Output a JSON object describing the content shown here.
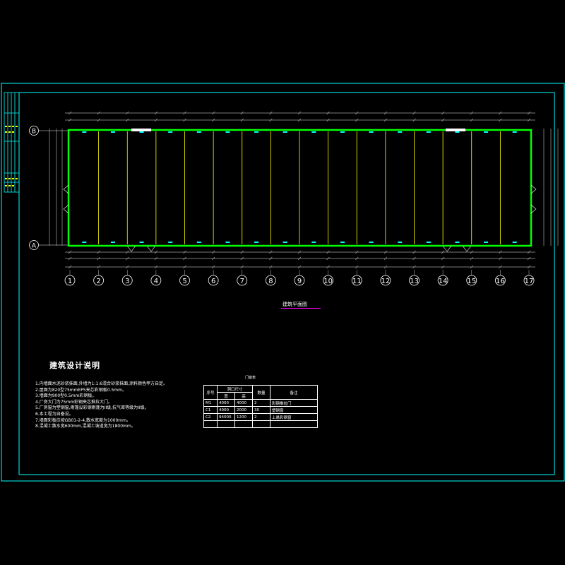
{
  "colors": {
    "background": "#000000",
    "frame": "#00ffff",
    "wall": "#00ff00",
    "grid": "#ffff00",
    "dimension": "#a0a0a0",
    "title_underline": "#ff00ff"
  },
  "plan": {
    "title": "建筑平面图",
    "axis_columns": [
      "1",
      "2",
      "3",
      "4",
      "5",
      "6",
      "7",
      "8",
      "9",
      "10",
      "11",
      "12",
      "13",
      "14",
      "15",
      "16",
      "17"
    ],
    "axis_rows": [
      "B",
      "A"
    ]
  },
  "notes": {
    "title": "建筑设计说明",
    "items": [
      "1.内墙面水泥砂浆抹面,外墙为1:1:6混合砂浆抹面,涂料颜色甲方自定。",
      "2.屋面为820型75mmEPS夹芯彩钢板0.5mm。",
      "3.墙面为900型0.5mm彩钢板。",
      "4.厂房大门为75mm彩钢夹芯推拉大门。",
      "5.厂房窗为塑钢窗,雨篷设彩钢雨蓬为II级,抗气密等级为II级。",
      "6.本工程为自备设。",
      "7.墙面彩板应按GB01-2-4,散水宽度为1000mm。",
      "8.混凝土散水宽600mm,混凝土坡道宽为1800mm。"
    ]
  },
  "door_table": {
    "title": "门窗表",
    "headers": {
      "no": "序号",
      "size": "洞口尺寸",
      "width": "宽",
      "height": "高",
      "count": "数量",
      "remark": "备注"
    },
    "rows": [
      {
        "no": "M1",
        "width": "4000",
        "height": "4000",
        "count": "2",
        "remark": "彩钢推拉门"
      },
      {
        "no": "C1",
        "width": "4000",
        "height": "2000",
        "count": "30",
        "remark": "塑钢窗"
      },
      {
        "no": "C2",
        "width": "94000",
        "height": "1200",
        "count": "2",
        "remark": "上悬彩钢窗"
      }
    ]
  }
}
